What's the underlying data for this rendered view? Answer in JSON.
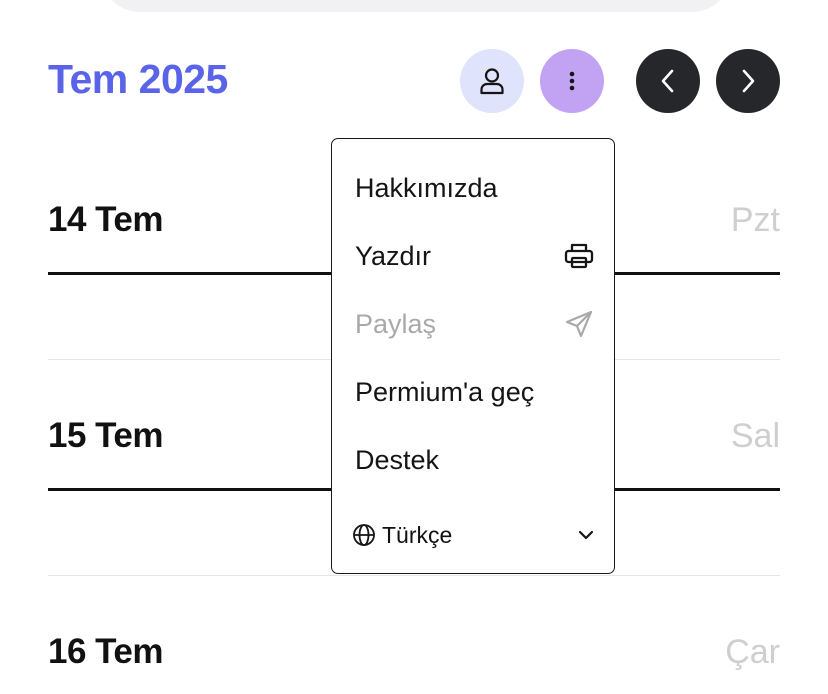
{
  "header": {
    "month_title": "Tem 2025"
  },
  "icons": {
    "user": "user-icon",
    "more": "more-vertical-icon",
    "prev": "chevron-left-icon",
    "next": "chevron-right-icon",
    "print": "printer-icon",
    "share": "send-icon",
    "globe": "globe-icon",
    "dropdown": "chevron-down-icon"
  },
  "colors": {
    "accent": "#5a64e8",
    "user_button_bg": "#dfe3fb",
    "more_button_bg": "#c2a3f3",
    "nav_button_bg": "#25272a",
    "weekday_text": "#cfcfcf",
    "disabled_text": "#a9a9a9"
  },
  "days": [
    {
      "date": "14 Tem",
      "weekday": "Pzt"
    },
    {
      "date": "15 Tem",
      "weekday": "Sal"
    },
    {
      "date": "16 Tem",
      "weekday": "Çar"
    }
  ],
  "menu": {
    "items": [
      {
        "label": "Hakkımızda"
      },
      {
        "label": "Yazdır"
      },
      {
        "label": "Paylaş",
        "disabled": true
      },
      {
        "label": "Permium'a geç"
      },
      {
        "label": "Destek"
      }
    ],
    "language": {
      "selected": "Türkçe"
    }
  }
}
